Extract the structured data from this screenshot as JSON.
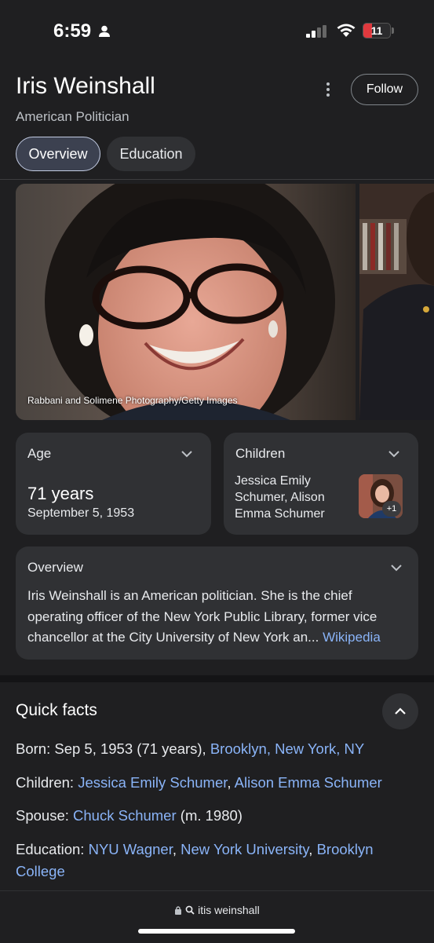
{
  "status": {
    "time": "6:59",
    "battery": "11",
    "battery_color": "#e0393e"
  },
  "header": {
    "title": "Iris Weinshall",
    "subtitle": "American Politician",
    "follow_label": "Follow",
    "more_icon": "more-vert-icon"
  },
  "tabs": [
    {
      "label": "Overview",
      "active": true
    },
    {
      "label": "Education",
      "active": false
    }
  ],
  "photos": {
    "credit": "Rabbani and Solimene Photography/Getty Images"
  },
  "age_card": {
    "title": "Age",
    "value": "71 years",
    "date": "September 5, 1953"
  },
  "children_card": {
    "title": "Children",
    "names": "Jessica Emily Schumer, Alison Emma Schumer",
    "more_badge": "+1"
  },
  "overview_card": {
    "title": "Overview",
    "text": "Iris Weinshall is an American politician. She is the chief operating officer of the New York Public Library, former vice chancellor at the City University of New York an...",
    "source_link": "Wikipedia"
  },
  "quick_facts": {
    "title": "Quick facts",
    "born": {
      "label": "Born",
      "text": ": Sep 5, 1953 (71 years), ",
      "place": "Brooklyn, New York, NY"
    },
    "children": {
      "label": "Children",
      "sep": ": ",
      "names": [
        "Jessica Emily Schumer",
        "Alison Emma Schumer"
      ]
    },
    "spouse": {
      "label": "Spouse",
      "sep": ": ",
      "name": "Chuck Schumer",
      "suffix": " (m. 1980)"
    },
    "education": {
      "label": "Education",
      "sep": ": ",
      "schools": [
        "NYU Wagner",
        "New York University",
        "Brooklyn College"
      ]
    }
  },
  "url_bar": {
    "query": "itis weinshall"
  },
  "colors": {
    "background": "#1f1f21",
    "card": "#303134",
    "link": "#8ab4f8",
    "active_tab": "#3c4150"
  }
}
